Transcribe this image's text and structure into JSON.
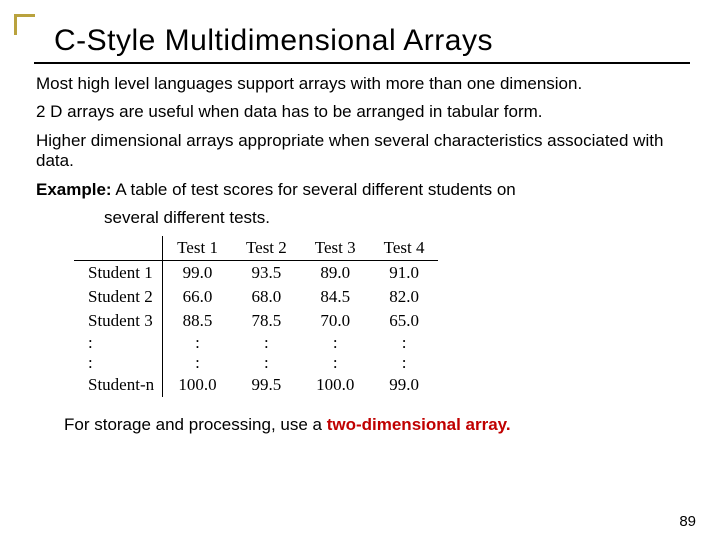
{
  "title": "C-Style Multidimensional Arrays",
  "para1": "Most high level languages support arrays with more than one dimension.",
  "para2": "2 D arrays are useful when data has to be arranged in tabular form.",
  "para3": "Higher dimensional arrays appropriate when several characteristics associated with data.",
  "example_label": "Example:",
  "example_text_a": "A table of test scores for several different students on",
  "example_text_b": "several different tests.",
  "footer_a": "For storage and processing, use a ",
  "footer_b": "two-dimensional array.",
  "pagenum": "89",
  "chart_data": {
    "type": "table",
    "columns": [
      "",
      "Test 1",
      "Test 2",
      "Test 3",
      "Test 4"
    ],
    "rows": [
      {
        "label": "Student 1",
        "values": [
          "99.0",
          "93.5",
          "89.0",
          "91.0"
        ]
      },
      {
        "label": "Student 2",
        "values": [
          "66.0",
          "68.0",
          "84.5",
          "82.0"
        ]
      },
      {
        "label": "Student 3",
        "values": [
          "88.5",
          "78.5",
          "70.0",
          "65.0"
        ]
      },
      {
        "label": ":",
        "values": [
          ":",
          ":",
          ":",
          ":"
        ]
      },
      {
        "label": ":",
        "values": [
          ":",
          ":",
          ":",
          ":"
        ]
      },
      {
        "label": "Student-n",
        "values": [
          "100.0",
          "99.5",
          "100.0",
          "99.0"
        ]
      }
    ]
  }
}
